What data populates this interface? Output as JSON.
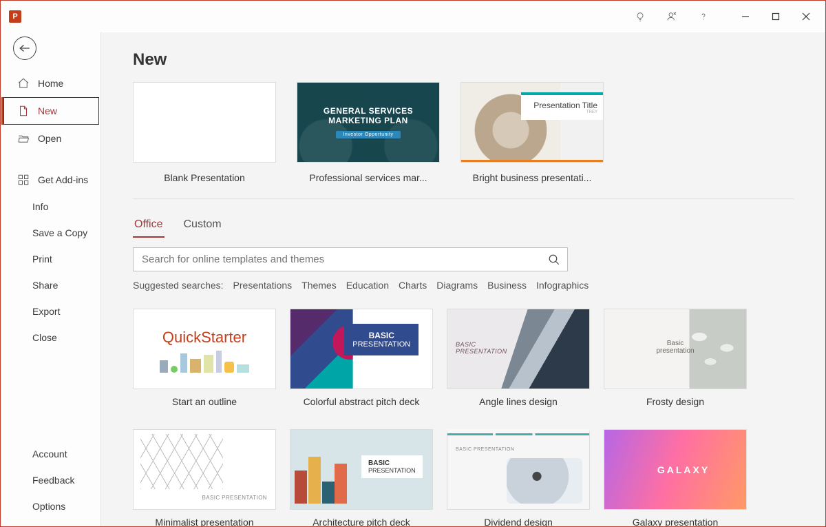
{
  "app": {
    "name": "PowerPoint"
  },
  "titlebar": {
    "icons": [
      "tips",
      "coming-soon",
      "help",
      "minimize",
      "restore",
      "close"
    ]
  },
  "sidebar": {
    "primary": [
      {
        "id": "home",
        "label": "Home",
        "icon": "home"
      },
      {
        "id": "new",
        "label": "New",
        "icon": "document"
      },
      {
        "id": "open",
        "label": "Open",
        "icon": "folder"
      }
    ],
    "secondary": [
      {
        "id": "addins",
        "label": "Get Add-ins",
        "icon": "addins"
      },
      {
        "id": "info",
        "label": "Info"
      },
      {
        "id": "saveacopy",
        "label": "Save a Copy"
      },
      {
        "id": "print",
        "label": "Print"
      },
      {
        "id": "share",
        "label": "Share"
      },
      {
        "id": "export",
        "label": "Export"
      },
      {
        "id": "close",
        "label": "Close"
      }
    ],
    "bottom": [
      {
        "id": "account",
        "label": "Account"
      },
      {
        "id": "feedback",
        "label": "Feedback"
      },
      {
        "id": "options",
        "label": "Options"
      }
    ],
    "active": "new"
  },
  "page": {
    "title": "New",
    "top_templates": [
      {
        "id": "blank",
        "label": "Blank Presentation",
        "thumb": "blank"
      },
      {
        "id": "general",
        "label": "Professional services mar...",
        "thumb": "general",
        "thumb_text": {
          "line1": "GENERAL SERVICES",
          "line2": "MARKETING PLAN",
          "badge": "Investor Opportunity"
        }
      },
      {
        "id": "bright",
        "label": "Bright business presentati...",
        "thumb": "bright",
        "thumb_text": {
          "title": "Presentation Title",
          "brand": "TREY"
        }
      }
    ],
    "tabs": [
      {
        "id": "office",
        "label": "Office",
        "active": true
      },
      {
        "id": "custom",
        "label": "Custom",
        "active": false
      }
    ],
    "search": {
      "placeholder": "Search for online templates and themes"
    },
    "suggested_label": "Suggested searches:",
    "suggested": [
      "Presentations",
      "Themes",
      "Education",
      "Charts",
      "Diagrams",
      "Business",
      "Infographics"
    ],
    "grid": [
      {
        "id": "quickstarter",
        "label": "Start an outline",
        "thumb": "quick",
        "thumb_text": {
          "title": "QuickStarter"
        }
      },
      {
        "id": "colorful",
        "label": "Colorful abstract pitch deck",
        "thumb": "colorful",
        "thumb_text": {
          "line1": "BASIC",
          "line2": "PRESENTATION"
        }
      },
      {
        "id": "angle",
        "label": "Angle lines design",
        "thumb": "angle",
        "thumb_text": {
          "line1": "BASIC",
          "line2": "PRESENTATION"
        }
      },
      {
        "id": "frosty",
        "label": "Frosty design",
        "thumb": "frosty",
        "thumb_text": {
          "line1": "Basic",
          "line2": "presentation"
        }
      },
      {
        "id": "minimalist",
        "label": "Minimalist presentation",
        "thumb": "min",
        "thumb_text": {
          "line1": "BASIC PRESENTATION"
        }
      },
      {
        "id": "architecture",
        "label": "Architecture pitch deck",
        "thumb": "arch",
        "thumb_text": {
          "line1": "BASIC",
          "line2": "PRESENTATION"
        }
      },
      {
        "id": "dividend",
        "label": "Dividend design",
        "thumb": "div",
        "thumb_text": {
          "line1": "BASIC PRESENTATION"
        }
      },
      {
        "id": "galaxy",
        "label": "Galaxy presentation",
        "thumb": "galaxy",
        "thumb_text": {
          "title": "GALAXY"
        }
      }
    ]
  }
}
